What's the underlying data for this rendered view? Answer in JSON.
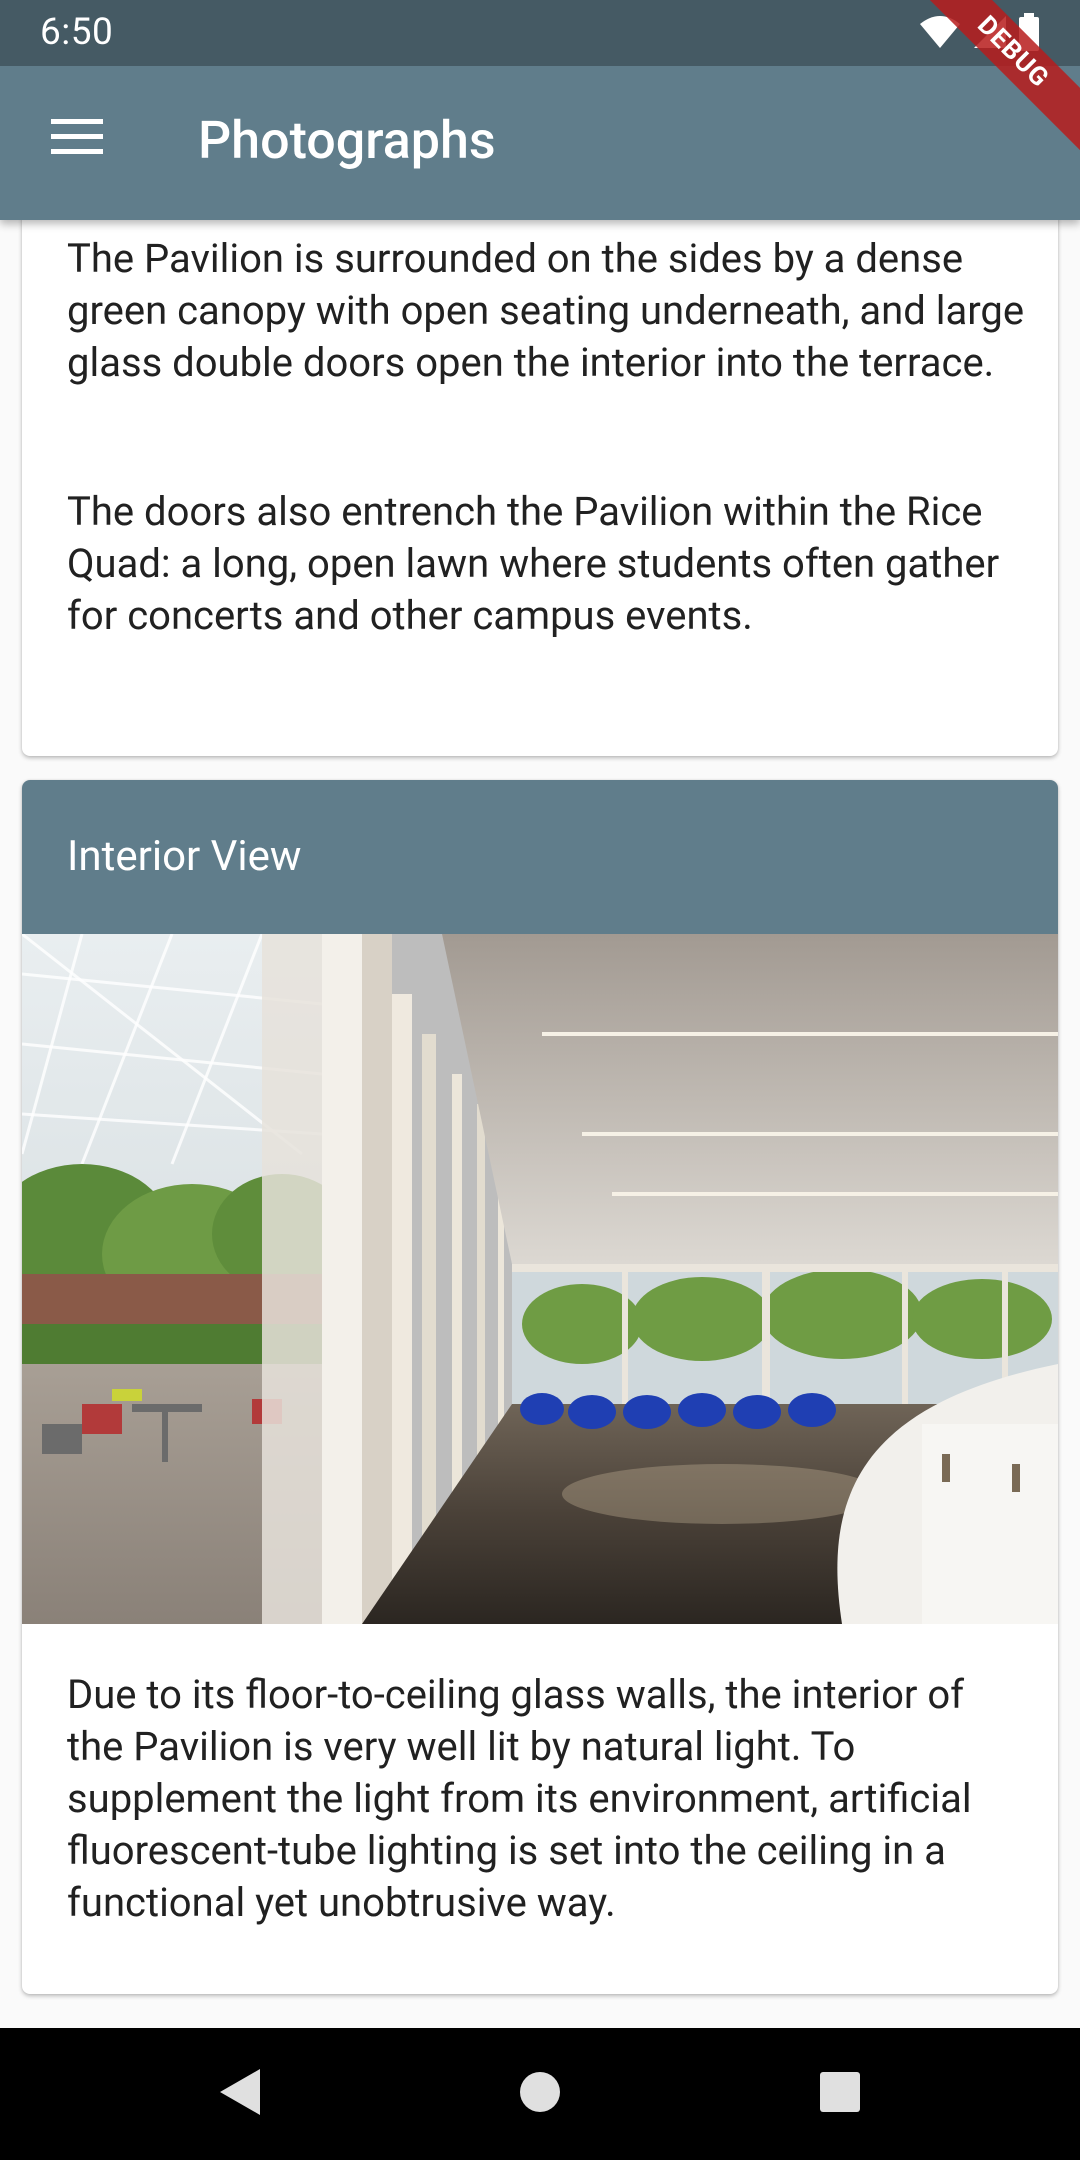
{
  "status_bar": {
    "time": "6:50",
    "icons": [
      "wifi-icon",
      "cell-signal-icon",
      "battery-icon"
    ]
  },
  "debug_banner": {
    "label": "DEBUG"
  },
  "app_bar": {
    "title": "Photographs",
    "menu_icon": "menu-icon"
  },
  "cards": [
    {
      "paragraphs": [
        "The Pavilion is surrounded on the sides by a dense green canopy with open seating underneath, and large glass double doors open the interior into the terrace.",
        "The doors also entrench the Pavilion within the Rice Quad: a long, open lawn where students often gather for concerts and other campus events."
      ]
    },
    {
      "title": "Interior View",
      "paragraphs": [
        "Due to its floor-to-ceiling glass walls, the interior of the Pavilion is very well lit by natural light. To supplement the light from its environment, artificial fluorescent-tube lighting is set into the ceiling in a functional yet unobtrusive way."
      ]
    }
  ],
  "nav_bar": {
    "buttons": [
      "back-icon",
      "home-icon",
      "recents-icon"
    ]
  },
  "colors": {
    "status_bar": "#455a64",
    "primary": "#607d8b",
    "debug": "#b71c1c",
    "background": "#fafafa"
  }
}
